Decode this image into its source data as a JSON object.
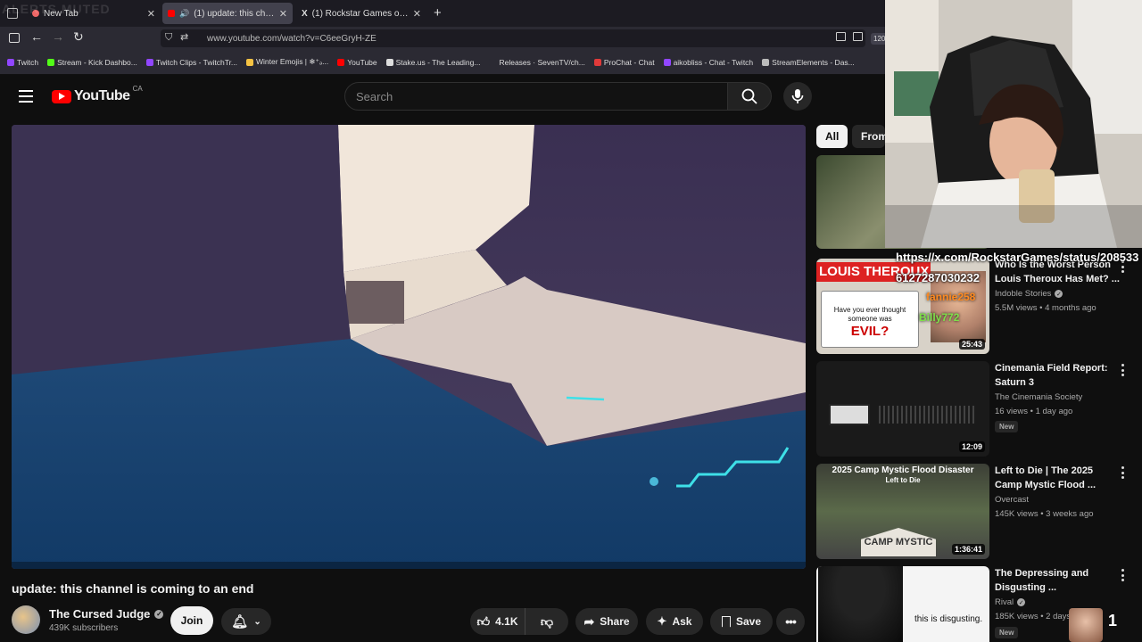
{
  "browser": {
    "tabs": [
      {
        "label": "New Tab",
        "overlay": "ALERTS MUTED"
      },
      {
        "label": "(1) update: this channel is c"
      },
      {
        "label": "(1) Rockstar Games on X: \"Gran"
      }
    ],
    "url": "www.youtube.com/watch?v=C6eeGryH-ZE",
    "zoom": "120",
    "bookmarks": [
      {
        "label": "Twitch",
        "color": "#9146ff"
      },
      {
        "label": "Stream - Kick Dashbo...",
        "color": "#53fc18"
      },
      {
        "label": "Twitch Clips - TwitchTr...",
        "color": "#9146ff"
      },
      {
        "label": "Winter Emojis | ❄⁺ₔ...",
        "color": "#f6c343"
      },
      {
        "label": "YouTube",
        "color": "#ff0000"
      },
      {
        "label": "Stake.us - The Leading...",
        "color": "#dddddd"
      },
      {
        "label": "Releases · SevenTV/ch...",
        "color": "#2b2a33"
      },
      {
        "label": "ProChat - Chat",
        "color": "#e03a3a"
      },
      {
        "label": "aikobliss - Chat - Twitch",
        "color": "#9146ff"
      },
      {
        "label": "StreamElements - Das...",
        "color": "#bbbbbb"
      }
    ]
  },
  "youtube": {
    "logo": "YouTube",
    "region": "CA",
    "search_placeholder": "Search"
  },
  "video": {
    "title": "update: this channel is coming to an end",
    "channel": "The Cursed Judge",
    "subscribers": "439K subscribers",
    "join": "Join",
    "likes": "4.1K",
    "share": "Share",
    "ask": "Ask",
    "save": "Save"
  },
  "chips": [
    "All",
    "From"
  ],
  "recommendations": [
    {
      "title": "Who Is the Worst Person Louis Theroux Has Met? ...",
      "channel": "Indoble Stories",
      "verified": true,
      "meta": "5.5M views • 4 months ago",
      "duration": "25:43",
      "thumb_text": [
        "LOUIS THEROUX",
        "Have you ever thought someone was",
        "EVIL?"
      ]
    },
    {
      "title": "Cinemania Field Report: Saturn 3",
      "channel": "The Cinemania Society",
      "verified": false,
      "meta": "16 views • 1 day ago",
      "duration": "12:09",
      "new": "New"
    },
    {
      "title": "Left to Die | The 2025 Camp Mystic Flood ...",
      "channel": "Overcast",
      "verified": false,
      "meta": "145K views • 3 weeks ago",
      "duration": "1:36:41",
      "thumb_text": [
        "2025 Camp Mystic Flood Disaster",
        "Left to Die",
        "CAMP MYSTIC"
      ]
    },
    {
      "title": "The Depressing and Disgusting ...",
      "channel": "Rival",
      "verified": true,
      "meta": "185K views • 2 days ago",
      "new": "New",
      "thumb_text": [
        "this is disgusting."
      ]
    }
  ],
  "overlay": {
    "url_line1": "https://x.com/RockstarGames/status/208533",
    "url_line2": "6127287030232",
    "chat_names": [
      "fannie258",
      "Billy772"
    ],
    "counter": "1"
  },
  "colors": {
    "accent": "#ff0000",
    "bg": "#0f0f0f",
    "chip_active": "#f1f1f1"
  }
}
